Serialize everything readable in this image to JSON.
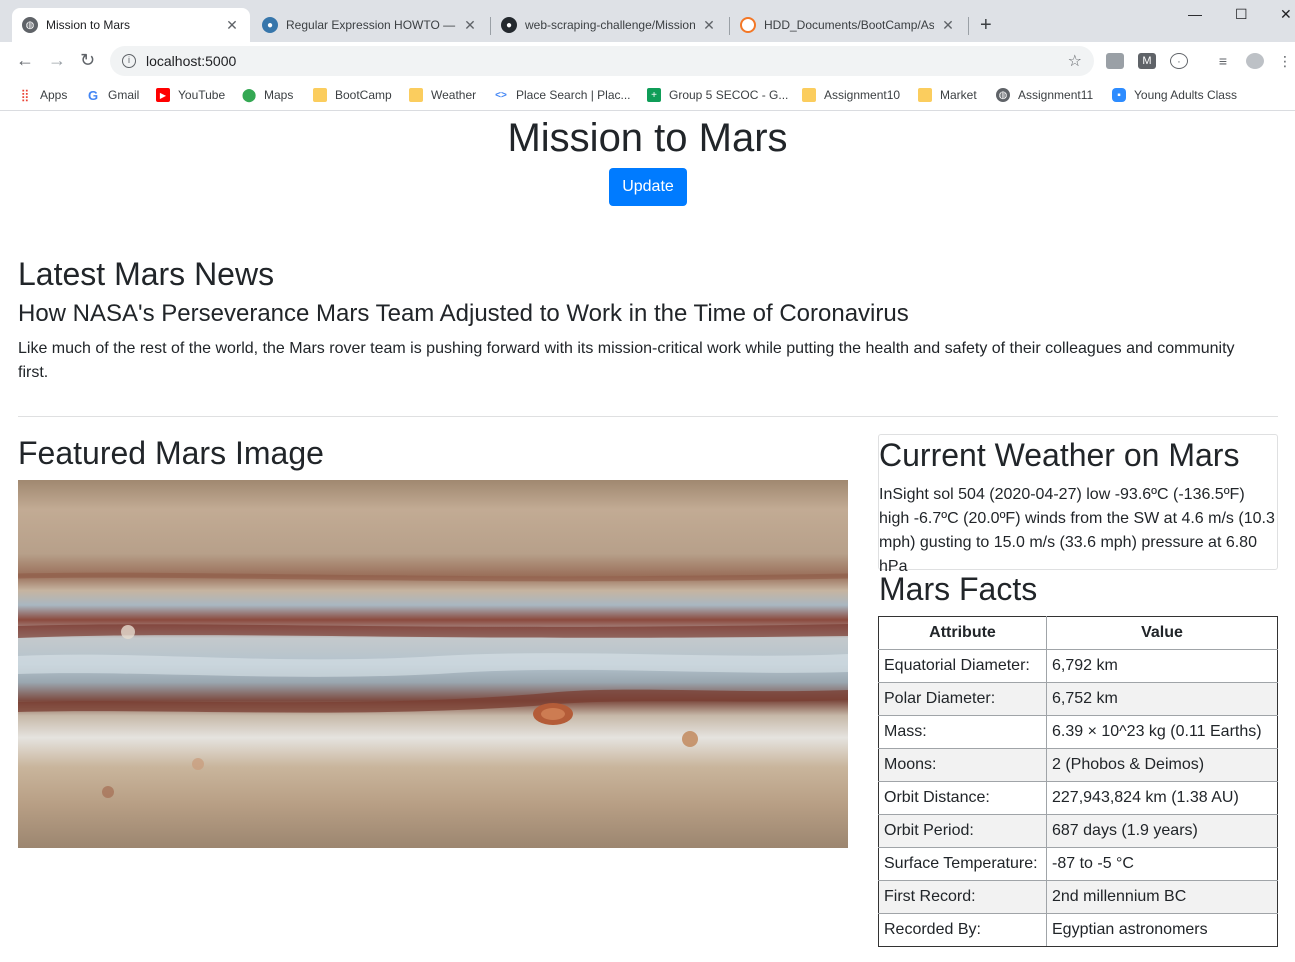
{
  "browser": {
    "tabs": [
      {
        "title": "Mission to Mars",
        "favicon": "globe-icon",
        "active": true
      },
      {
        "title": "Regular Expression HOWTO — Py",
        "favicon": "python-icon",
        "active": false
      },
      {
        "title": "web-scraping-challenge/Mission",
        "favicon": "github-icon",
        "active": false
      },
      {
        "title": "HDD_Documents/BootCamp/Ass",
        "favicon": "jupyter-icon",
        "active": false
      }
    ],
    "new_tab": "+",
    "address": "localhost:5000",
    "bookmarks": [
      {
        "label": "Apps",
        "icon": "apps-grid-icon",
        "color": "#ea4335"
      },
      {
        "label": "Gmail",
        "icon": "google-icon",
        "color": "#4285f4"
      },
      {
        "label": "YouTube",
        "icon": "youtube-icon",
        "color": "#ff0000"
      },
      {
        "label": "Maps",
        "icon": "maps-pin-icon",
        "color": "#34a853"
      },
      {
        "label": "BootCamp",
        "icon": "folder-icon",
        "color": "#fbcd5e"
      },
      {
        "label": "Weather",
        "icon": "folder-icon",
        "color": "#fbcd5e"
      },
      {
        "label": "Place Search | Plac...",
        "icon": "code-icon",
        "color": "#4285f4"
      },
      {
        "label": "Group 5 SECOC - G...",
        "icon": "sheets-icon",
        "color": "#0f9d58"
      },
      {
        "label": "Assignment10",
        "icon": "folder-icon",
        "color": "#fbcd5e"
      },
      {
        "label": "Market",
        "icon": "folder-icon",
        "color": "#fbcd5e"
      },
      {
        "label": "Assignment11",
        "icon": "globe-icon",
        "color": "#5f6368"
      },
      {
        "label": "Young Adults Class",
        "icon": "zoom-icon",
        "color": "#2d8cff"
      }
    ]
  },
  "page": {
    "title": "Mission to Mars",
    "update_button": "Update",
    "news": {
      "heading": "Latest Mars News",
      "title": "How NASA's Perseverance Mars Team Adjusted to Work in the Time of Coronavirus",
      "paragraph": "Like much of the rest of the world, the Mars rover team is pushing forward with its mission-critical work while putting the health and safety of their colleagues and community first."
    },
    "featured": {
      "heading": "Featured Mars Image",
      "image": "jupyter-bands-image"
    },
    "weather": {
      "heading": "Current Weather on Mars",
      "text": "InSight sol 504 (2020-04-27) low -93.6ºC (-136.5ºF) high -6.7ºC (20.0ºF) winds from the SW at 4.6 m/s (10.3 mph) gusting to 15.0 m/s (33.6 mph) pressure at 6.80 hPa"
    },
    "facts": {
      "heading": "Mars Facts",
      "columns": [
        "Attribute",
        "Value"
      ],
      "rows": [
        [
          "Equatorial Diameter:",
          "6,792 km"
        ],
        [
          "Polar Diameter:",
          "6,752 km"
        ],
        [
          "Mass:",
          "6.39 × 10^23 kg (0.11 Earths)"
        ],
        [
          "Moons:",
          "2 (Phobos & Deimos)"
        ],
        [
          "Orbit Distance:",
          "227,943,824 km (1.38 AU)"
        ],
        [
          "Orbit Period:",
          "687 days (1.9 years)"
        ],
        [
          "Surface Temperature:",
          "-87 to -5 °C"
        ],
        [
          "First Record:",
          "2nd millennium BC"
        ],
        [
          "Recorded By:",
          "Egyptian astronomers"
        ]
      ]
    }
  },
  "colors": {
    "primary": "#007bff",
    "text": "#212529"
  }
}
